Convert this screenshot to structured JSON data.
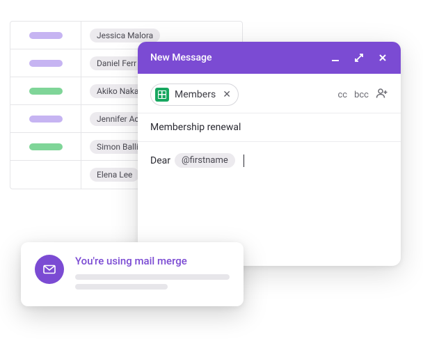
{
  "table": {
    "rows": [
      {
        "pill_color": "purple",
        "name": "Jessica Malora"
      },
      {
        "pill_color": "purple",
        "name": "Daniel Ferr"
      },
      {
        "pill_color": "green",
        "name": "Akiko Naka"
      },
      {
        "pill_color": "purple",
        "name": "Jennifer Ac"
      },
      {
        "pill_color": "green",
        "name": "Simon Balli"
      },
      {
        "pill_color": "",
        "name": "Elena Lee"
      }
    ]
  },
  "compose": {
    "title": "New Message",
    "recipient_chip": "Members",
    "cc_label": "cc",
    "bcc_label": "bcc",
    "subject": "Membership renewal",
    "body_prefix": "Dear",
    "variable_chip": "@firstname"
  },
  "toast": {
    "title": "You're using mail merge"
  }
}
